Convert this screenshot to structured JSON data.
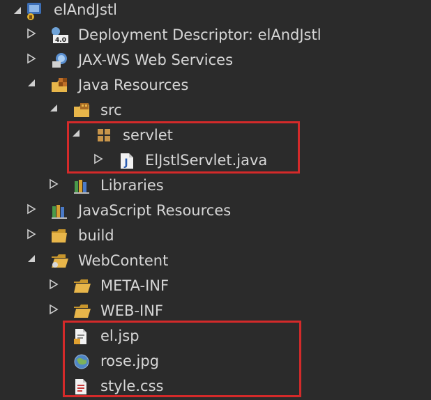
{
  "tree": {
    "nodes": [
      {
        "label": "elAndJstl",
        "icon": "web-project-icon",
        "state": "expanded"
      },
      {
        "label": "Deployment Descriptor: elAndJstl",
        "icon": "deployment-descriptor-icon",
        "state": "collapsed"
      },
      {
        "label": "JAX-WS Web Services",
        "icon": "web-services-icon",
        "state": "collapsed"
      },
      {
        "label": "Java Resources",
        "icon": "java-resources-icon",
        "state": "expanded"
      },
      {
        "label": "src",
        "icon": "source-folder-icon",
        "state": "expanded"
      },
      {
        "label": "servlet",
        "icon": "package-icon",
        "state": "expanded"
      },
      {
        "label": "ElJstlServlet.java",
        "icon": "java-file-icon",
        "state": "collapsed"
      },
      {
        "label": "Libraries",
        "icon": "libraries-icon",
        "state": "collapsed"
      },
      {
        "label": "JavaScript Resources",
        "icon": "javascript-resources-icon",
        "state": "collapsed"
      },
      {
        "label": "build",
        "icon": "folder-icon",
        "state": "collapsed"
      },
      {
        "label": "WebContent",
        "icon": "web-folder-icon",
        "state": "expanded"
      },
      {
        "label": "META-INF",
        "icon": "folder-icon",
        "state": "collapsed"
      },
      {
        "label": "WEB-INF",
        "icon": "folder-icon",
        "state": "collapsed"
      },
      {
        "label": "el.jsp",
        "icon": "jsp-file-icon",
        "state": "leaf"
      },
      {
        "label": "rose.jpg",
        "icon": "image-file-icon",
        "state": "leaf"
      },
      {
        "label": "style.css",
        "icon": "css-file-icon",
        "state": "leaf"
      }
    ]
  },
  "colors": {
    "background": "#2b2b2b",
    "text": "#d6d6d6",
    "highlight": "#d42a2a",
    "folder": "#e8b64a"
  }
}
